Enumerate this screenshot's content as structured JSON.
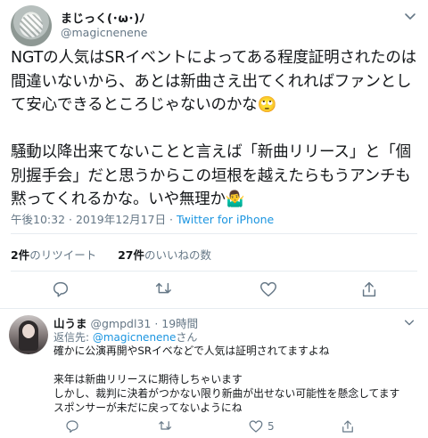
{
  "tweet": {
    "display_name": "まじっく(･ω･)ﾉ",
    "handle": "@magicnenene",
    "text": "NGTの人気はSRイベントによってある程度証明されたのは間違いないから、あとは新曲さえ出てくれればファンとして安心できるところじゃないのかな🙄\n\n騒動以降出来てないことと言えば「新曲リリース」と「個別握手会」だと思うからこの垣根を越えたらもうアンチも黙ってくれるかな。いや無理か🤷‍♂️",
    "time": "午後10:32",
    "date": "2019年12月17日",
    "app": "Twitter for iPhone",
    "retweets_count": "2件",
    "retweets_label": "のリツイート",
    "likes_count": "27件",
    "likes_label": "のいいねの数"
  },
  "actions": {
    "reply_icon": "reply-icon",
    "retweet_icon": "retweet-icon",
    "like_icon": "heart-icon",
    "share_icon": "share-icon"
  },
  "reply": {
    "display_name": "山うま",
    "handle": "@gmpdl31",
    "age": "19時間",
    "replying_prefix": "返信先: ",
    "replying_mention": "@magicnenene",
    "replying_suffix": "さん",
    "text": "確かに公演再開やSRイベなどで人気は証明されてますよね\n\n来年は新曲リリースに期待しちゃいます\nしかし、裁判に決着がつかない限り新曲が出せない可能性を懸念してます\nスポンサーが未だに戻ってないようにね",
    "like_count": "5"
  },
  "colors": {
    "link": "#1b95e0",
    "secondary_text": "#657786",
    "divider": "#e6ecf0"
  }
}
